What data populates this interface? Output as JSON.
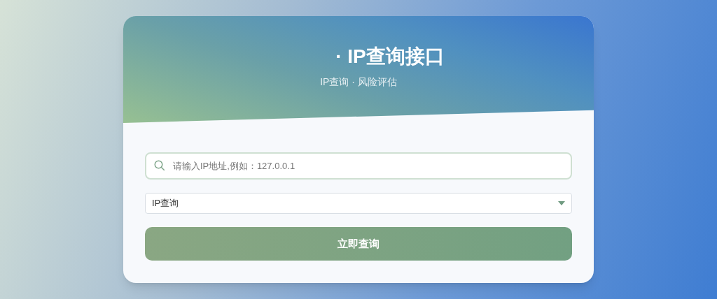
{
  "header": {
    "title": "· IP查询接口",
    "subtitle": "IP查询 · 风险评估"
  },
  "search": {
    "placeholder": "请输入IP地址,例如：127.0.0.1"
  },
  "query_type": {
    "value": "IP查询"
  },
  "submit_button": {
    "label": "立即查询"
  }
}
